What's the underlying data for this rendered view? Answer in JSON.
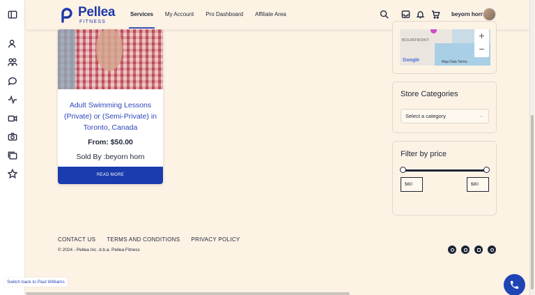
{
  "header": {
    "logo_name": "Pellea",
    "logo_sub": "FITNESS",
    "nav": [
      "Services",
      "My Account",
      "Pro Dashboard",
      "Affiliate Area"
    ],
    "active_nav": "Services",
    "user_name": "beyorn horn"
  },
  "rail_icons": [
    "sidebar-toggle-icon",
    "people-icon",
    "group-icon",
    "chat-icon",
    "activity-icon",
    "video-icon",
    "camera-icon",
    "folders-icon",
    "star-icon"
  ],
  "product": {
    "title": "Adult Swimming Lessons (Private) or (Semi-Private) in Toronto, Canada",
    "price": "From: $50.00",
    "seller": "Sold By :beyorn horn",
    "button": "READ MORE"
  },
  "map": {
    "label": "BOURFRONT",
    "google": "Google",
    "attribution": "Map Data   Terms",
    "zoom_in": "+",
    "zoom_out": "−"
  },
  "store_categories": {
    "title": "Store Categories",
    "select_value": "Select a category"
  },
  "price_filter": {
    "title": "Filter by price",
    "min": "$60",
    "max": "$80",
    "range_start": 0.0,
    "range_end": 1.0
  },
  "footer": {
    "links": [
      "CONTACT US",
      "TERMS AND CONDITIONS",
      "PRIVACY POLICY"
    ],
    "copyright": "© 2024 - Pellea Inc. d.b.a. Pellea Fitness",
    "social": [
      "facebook-icon",
      "instagram-icon",
      "linkedin-icon",
      "twitter-icon"
    ]
  },
  "switch_back": "Switch back to Paul Williams",
  "colors": {
    "background": "#fdf3e5",
    "brand_blue": "#1a3cae",
    "text_dark": "#1d2335"
  }
}
